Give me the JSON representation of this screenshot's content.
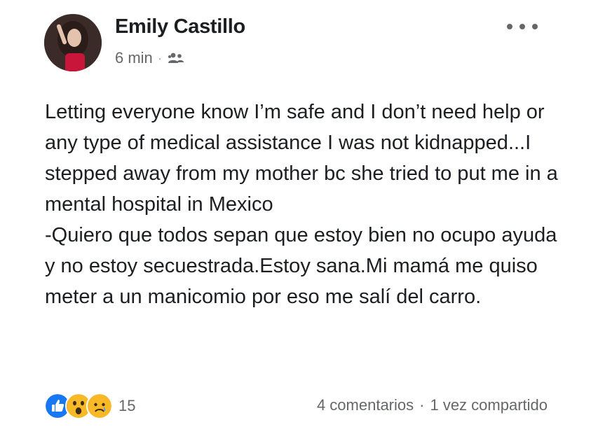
{
  "post": {
    "author": "Emily Castillo",
    "time": "6 min",
    "separator": "·",
    "audience_icon": "friends-icon",
    "paragraphs": [
      "Letting everyone know I’m safe and I don’t need help or any type of medical assistance I was not kidnapped...I stepped away from my mother bc she tried to put me in a mental hospital in Mexico",
      "-Quiero que todos sepan que estoy bien no ocupo ayuda y no estoy secuestrada.Estoy sana.Mi mamá me quiso meter a un manicomio por eso me salí del carro."
    ]
  },
  "reactions": {
    "icons": [
      "like-icon",
      "wow-icon",
      "sad-icon"
    ],
    "count": "15"
  },
  "footer": {
    "comments": "4 comentarios",
    "separator": "·",
    "shares": "1 vez compartido"
  },
  "colors": {
    "like_blue": "#1877f2",
    "reaction_yellow": "#f7b928",
    "secondary_text": "#65676b"
  }
}
